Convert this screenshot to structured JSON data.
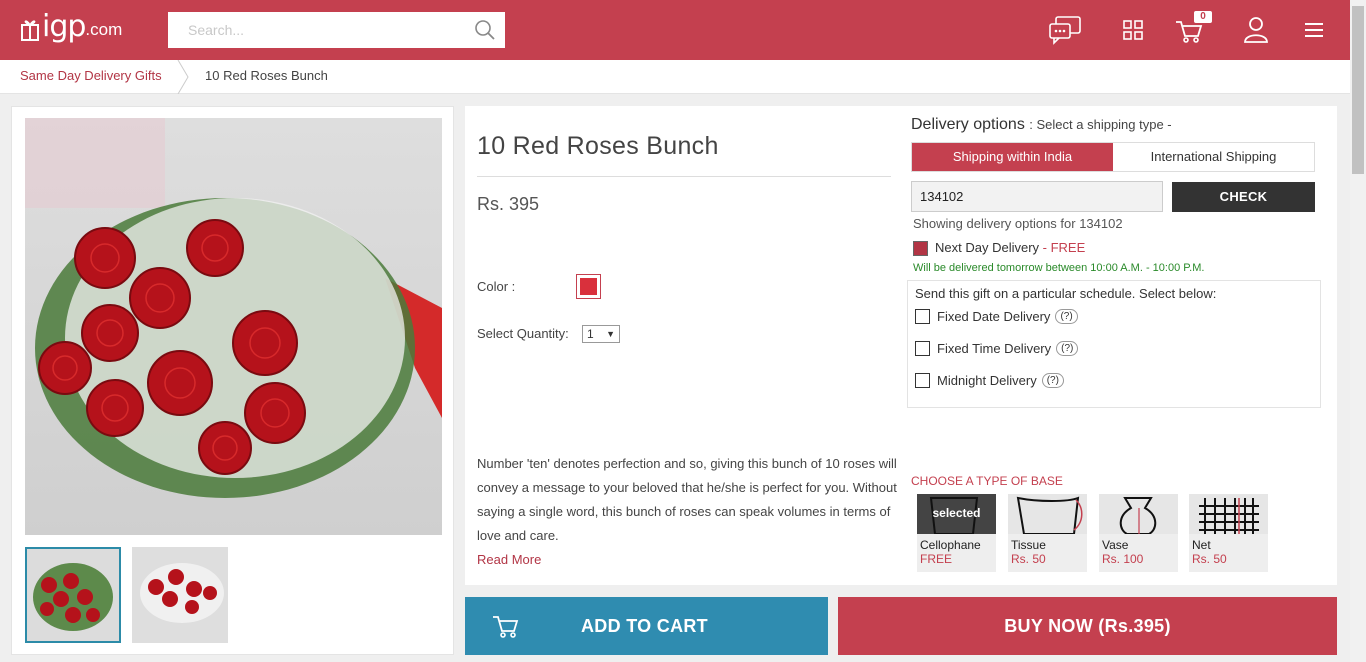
{
  "header": {
    "logo_main": "igp",
    "logo_suffix": ".com",
    "search_placeholder": "Search...",
    "cart_count": "0",
    "icons": [
      "chat-icon",
      "grid-icon",
      "cart-icon",
      "user-icon",
      "menu-icon"
    ]
  },
  "breadcrumb": {
    "items": [
      "Same Day Delivery Gifts",
      "10 Red Roses Bunch"
    ]
  },
  "product": {
    "title": "10 Red Roses Bunch",
    "price": "Rs. 395",
    "color_label": "Color :",
    "color_value": "#d9303c",
    "quantity_label": "Select Quantity:",
    "quantity_value": "1",
    "description": "Number 'ten' denotes perfection and so, giving this bunch of 10 roses will convey a message to your beloved that he/she is perfect for you. Without saying a single word, this bunch of roses can speak volumes in terms of love and care.",
    "read_more": "Read More"
  },
  "delivery": {
    "title": "Delivery options",
    "subtitle": ": Select a shipping type -",
    "tabs": [
      "Shipping within India",
      "International Shipping"
    ],
    "pincode": "134102",
    "check_label": "CHECK",
    "showing_text": "Showing delivery options for 134102",
    "next_day_label": "Next Day Delivery",
    "next_day_price": "- FREE",
    "next_day_note": "Will be delivered tomorrow between 10:00 A.M. - 10:00 P.M.",
    "schedule_title": "Send this gift on a particular schedule. Select below:",
    "schedule_options": [
      "Fixed Date Delivery",
      "Fixed Time Delivery",
      "Midnight Delivery"
    ],
    "help_label": "(?)"
  },
  "base": {
    "title": "CHOOSE A TYPE OF BASE",
    "selected_label": "selected",
    "options": [
      {
        "name": "Cellophane",
        "price": "FREE"
      },
      {
        "name": "Tissue",
        "price": "Rs. 50"
      },
      {
        "name": "Vase",
        "price": "Rs. 100"
      },
      {
        "name": "Net",
        "price": "Rs. 50"
      }
    ]
  },
  "actions": {
    "add_to_cart": "ADD TO CART",
    "buy_now": "BUY NOW (Rs.395)"
  },
  "colors": {
    "brand": "#c4404f",
    "cart_button": "#2f8cb0",
    "check_button": "#333333"
  }
}
